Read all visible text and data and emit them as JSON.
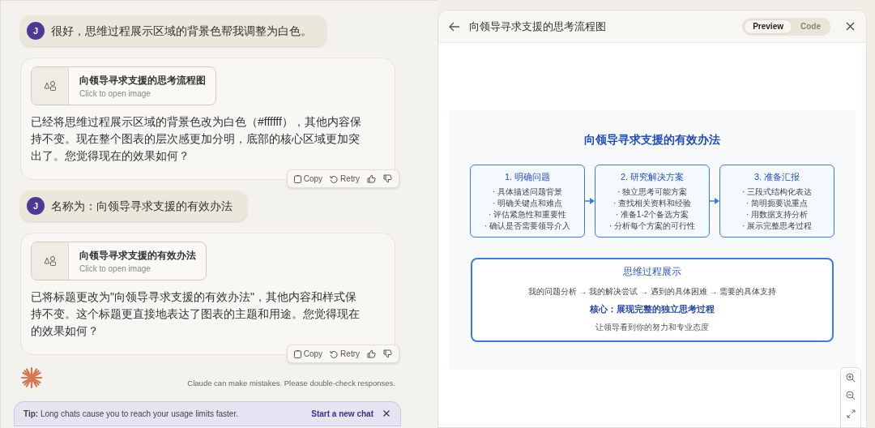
{
  "messages": [
    {
      "kind": "user",
      "avatar": "J",
      "text": "很好，思维过程展示区域的背景色帮我调整为白色。"
    },
    {
      "kind": "assistant",
      "attachment": {
        "title": "向领导寻求支援的思考流程图",
        "subtitle": "Click to open image"
      },
      "text": "已经将思维过程展示区域的背景色改为白色（#ffffff），其他内容保持不变。现在整个图表的层次感更加分明，底部的核心区域更加突出了。您觉得现在的效果如何？",
      "actions": [
        "Copy",
        "Retry"
      ]
    },
    {
      "kind": "user",
      "avatar": "J",
      "text": "名称为：向领导寻求支援的有效办法"
    },
    {
      "kind": "assistant",
      "attachment": {
        "title": "向领导寻求支援的有效办法",
        "subtitle": "Click to open image"
      },
      "text": "已将标题更改为\"向领导寻求支援的有效办法\"，其他内容和样式保持不变。这个标题更直接地表达了图表的主题和用途。您觉得现在的效果如何？",
      "actions": [
        "Copy",
        "Retry"
      ]
    }
  ],
  "disclaimer": "Claude can make mistakes. Please double-check responses.",
  "tip": {
    "label": "Tip:",
    "text": "Long chats cause you to reach your usage limits faster.",
    "link": "Start a new chat"
  },
  "artifact": {
    "title": "向领导寻求支援的思考流程图",
    "tabs": [
      {
        "label": "Preview",
        "selected": true
      },
      {
        "label": "Code",
        "selected": false
      }
    ],
    "diagram": {
      "title": "向领导寻求支援的有效办法",
      "steps": [
        {
          "title": "1. 明确问题",
          "bullets": [
            "· 具体描述问题背景",
            "· 明确关键点和难点",
            "· 评估紧急性和重要性",
            "· 确认是否需要领导介入"
          ]
        },
        {
          "title": "2. 研究解决方案",
          "bullets": [
            "· 独立思考可能方案",
            "· 查找相关资料和经验",
            "· 准备1-2个备选方案",
            "· 分析每个方案的可行性"
          ]
        },
        {
          "title": "3. 准备汇报",
          "bullets": [
            "· 三段式结构化表达",
            "· 简明扼要说重点",
            "· 用数据支持分析",
            "· 展示完整思考过程"
          ]
        }
      ],
      "summary": {
        "title": "思维过程展示",
        "flow": "我的问题分析 → 我的解决尝试 → 遇到的具体困难 → 需要的具体支持",
        "core": "核心：展现完整的独立思考过程",
        "note": "让领导看到你的努力和专业态度"
      }
    }
  }
}
